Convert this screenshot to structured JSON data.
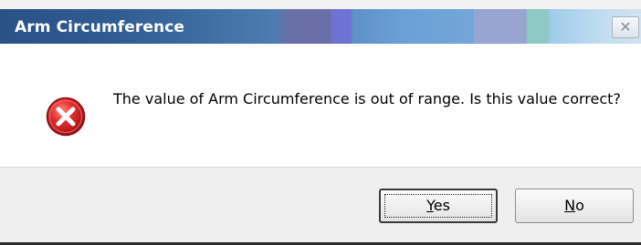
{
  "window": {
    "title": "Arm Circumference",
    "close_glyph": "✕"
  },
  "message": {
    "text": "The value of Arm Circumference is out of range. Is this value correct?",
    "icon": "error-icon"
  },
  "buttons": {
    "yes": {
      "accel": "Y",
      "rest": "es"
    },
    "no": {
      "accel": "N",
      "rest": "o"
    }
  },
  "colors": {
    "titlebar_start": "#2b5287",
    "titlebar_end": "#cfe3f3",
    "error_red": "#d8262b",
    "footer_bg": "#efefef"
  }
}
